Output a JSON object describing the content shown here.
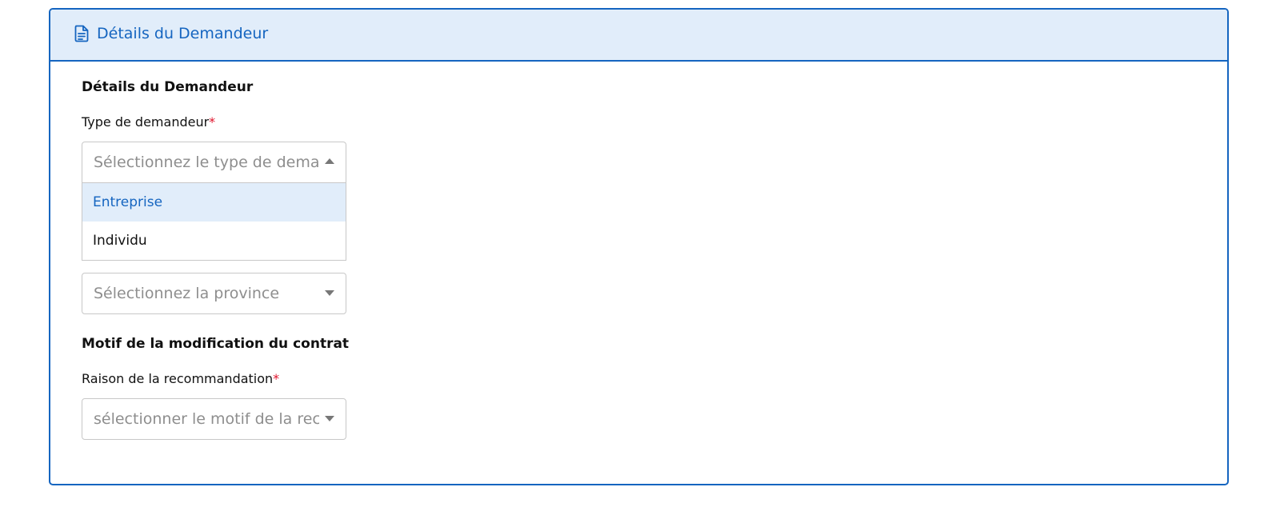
{
  "card": {
    "header_title": "Détails du Demandeur",
    "header_icon": "document-icon"
  },
  "applicant_section": {
    "title": "Détails du Demandeur",
    "type_field": {
      "label": "Type de demandeur",
      "required_mark": "*",
      "placeholder": "Sélectionnez le type de demandeur",
      "open": true,
      "options": [
        {
          "label": "Entreprise",
          "highlighted": true
        },
        {
          "label": "Individu",
          "highlighted": false
        }
      ]
    },
    "province_field": {
      "placeholder": "Sélectionnez la province"
    }
  },
  "reason_section": {
    "title": "Motif de la modification du contrat",
    "reason_field": {
      "label": "Raison de la recommandation",
      "required_mark": "*",
      "placeholder": "sélectionner le motif de la recommandation"
    }
  },
  "colors": {
    "accent": "#1565c0",
    "header_background": "#e1edfa",
    "required": "#e0142c",
    "placeholder": "#8e8e8e"
  }
}
